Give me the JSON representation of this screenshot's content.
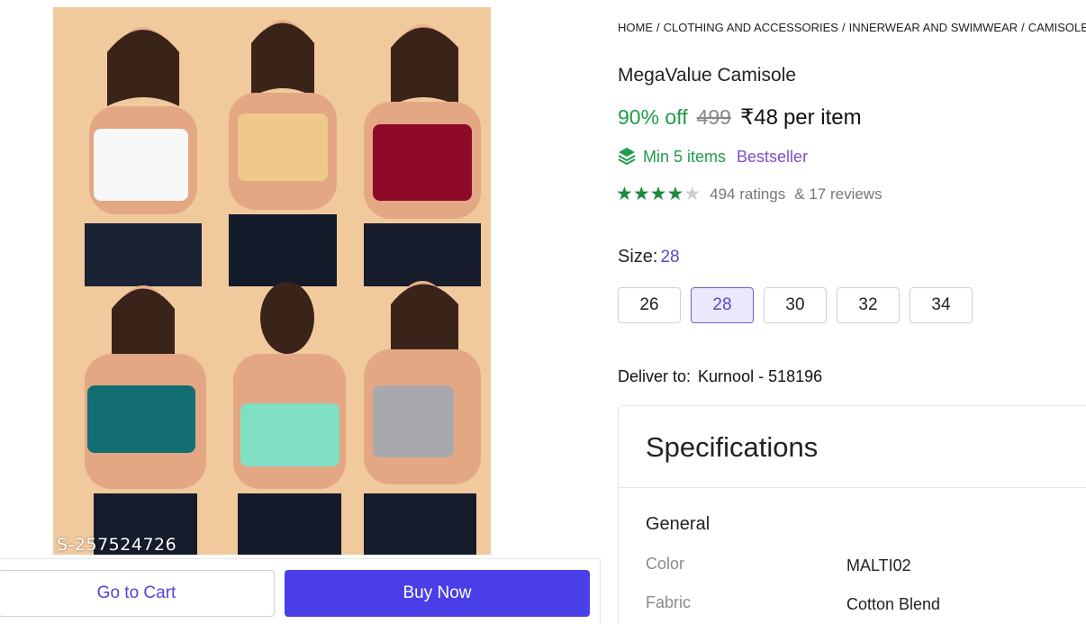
{
  "breadcrumb": [
    "HOME",
    "CLOTHING AND ACCESSORIES",
    "INNERWEAR AND SWIMWEAR",
    "CAMISOLES A"
  ],
  "product": {
    "title": "MegaValue Camisole",
    "discount": "90% off",
    "mrp": "499",
    "price": "₹48",
    "price_suffix": "per item",
    "min_items": "Min 5 items",
    "badge": "Bestseller",
    "rating": 4,
    "rating_max": 5,
    "ratings_count": "494 ratings",
    "reviews_count": "& 17 reviews"
  },
  "image": {
    "watermark": "S-257524726",
    "camisole_colors": [
      "#f7f7f7",
      "#efc98b",
      "#8e0a28",
      "#136e71",
      "#7fe0c4",
      "#a9a9ad"
    ]
  },
  "size": {
    "label": "Size:",
    "selected": "28",
    "options": [
      "26",
      "28",
      "30",
      "32",
      "34"
    ]
  },
  "delivery": {
    "label": "Deliver to:",
    "location": "Kurnool - 518196"
  },
  "specifications": {
    "title": "Specifications",
    "group": "General",
    "rows": [
      {
        "key": "Color",
        "value": "MALTI02"
      },
      {
        "key": "Fabric",
        "value": "Cotton Blend"
      }
    ]
  },
  "actions": {
    "cart": "Go to Cart",
    "buy": "Buy Now"
  },
  "colors": {
    "green": "#1f9c4a",
    "purple": "#7d4fc4",
    "accent": "#4a3ee8",
    "star": "#1a8a3c"
  },
  "icons": {
    "min_items": "stack-icon",
    "star": "star-icon"
  }
}
